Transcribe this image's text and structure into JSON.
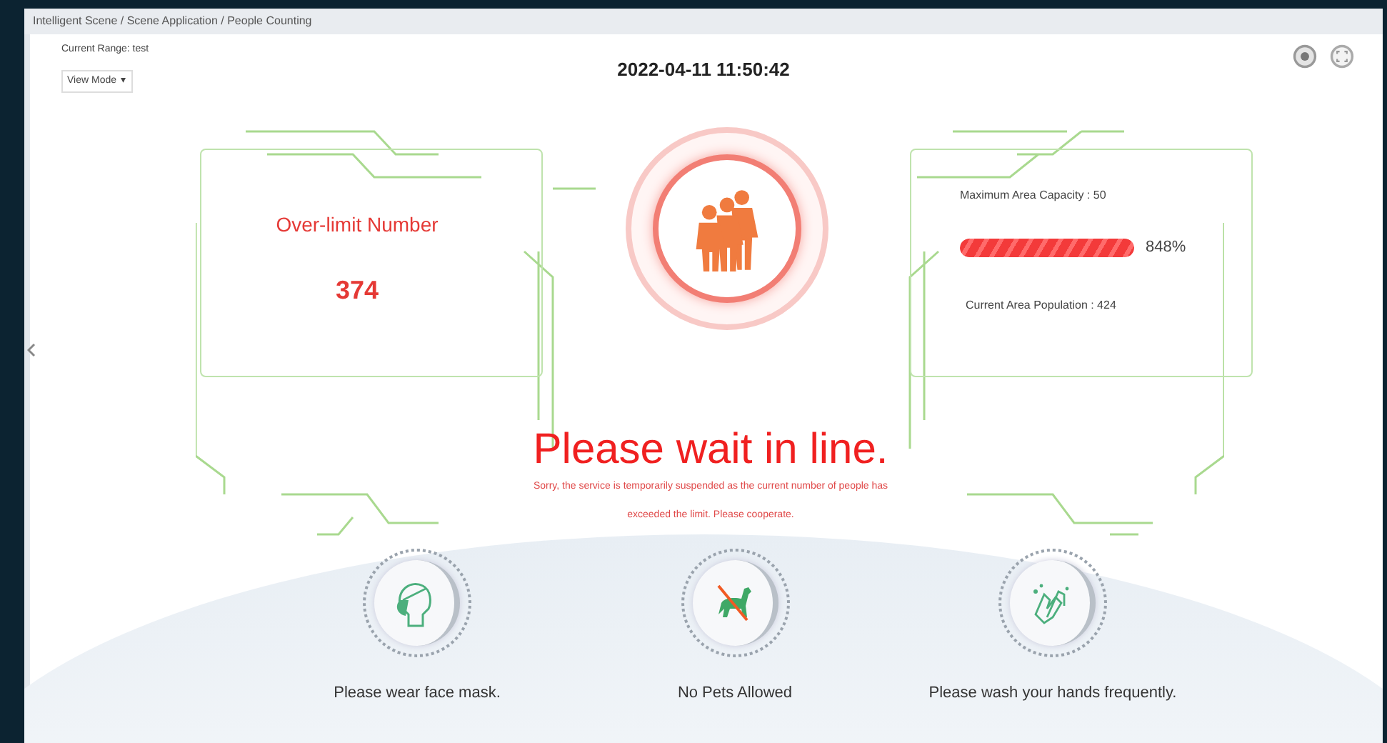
{
  "breadcrumb": "Intelligent Scene / Scene Application / People Counting",
  "current_range": "Current Range: test",
  "view_mode": {
    "label": "View Mode",
    "caret": "▾"
  },
  "datetime": "2022-04-11 11:50:42",
  "over_limit": {
    "label": "Over-limit Number",
    "value": "374"
  },
  "capacity": {
    "label": "Maximum Area Capacity : 50",
    "level": 1,
    "percent": "848%",
    "population": "Current Area Population : 424"
  },
  "headline": "Please wait in line.",
  "message": [
    "Sorry, the service is temporarily suspended as the current number of people has",
    "exceeded the limit. Please cooperate."
  ],
  "signs": [
    {
      "kind": "mask",
      "label": "Please wear face mask."
    },
    {
      "kind": "no_pets",
      "label": "No Pets Allowed"
    },
    {
      "kind": "handwash",
      "label": "Please wash your hands frequently."
    }
  ]
}
